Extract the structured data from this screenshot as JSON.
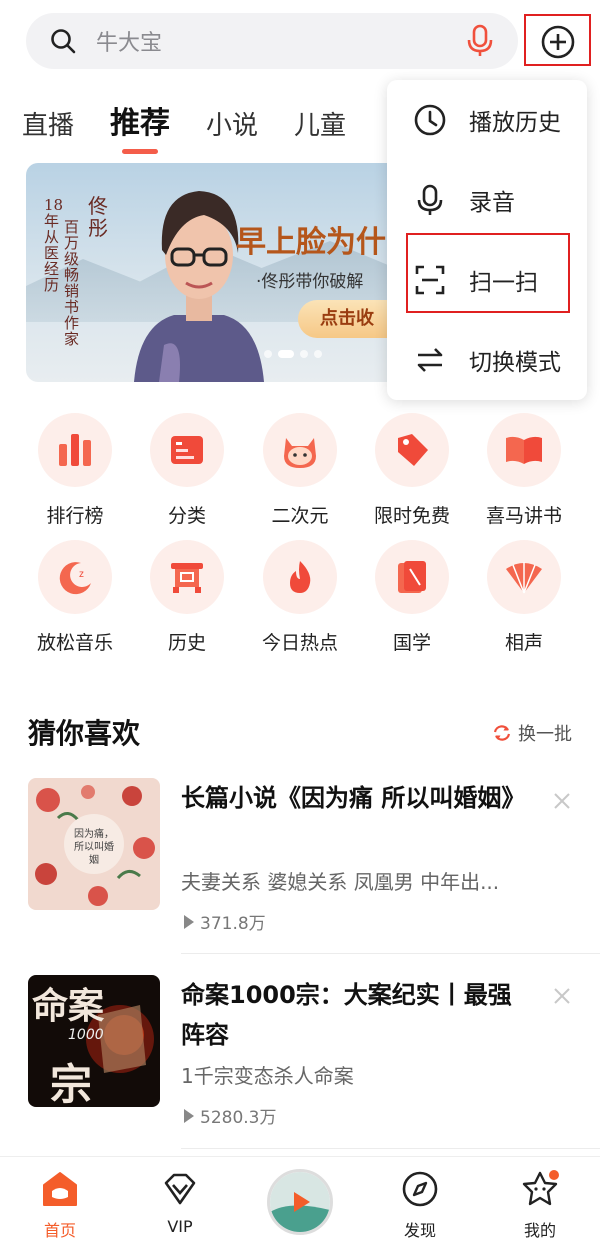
{
  "search": {
    "placeholder": "牛大宝"
  },
  "tabs": [
    "直播",
    "推荐",
    "小说",
    "儿童"
  ],
  "banner": {
    "vertical_1": "18年从医经历",
    "vertical_2": "百万级畅销书作家",
    "vertical_3": "佟彤",
    "headline": "早上脸为什",
    "subline": "·佟彤带你破解",
    "cta": "点击收"
  },
  "menu": [
    "播放历史",
    "录音",
    "扫一扫",
    "切换模式"
  ],
  "grid": [
    {
      "label": "排行榜",
      "icon": "ranking-icon"
    },
    {
      "label": "分类",
      "icon": "category-icon"
    },
    {
      "label": "二次元",
      "icon": "anime-icon"
    },
    {
      "label": "限时免费",
      "icon": "free-tag-icon"
    },
    {
      "label": "喜马讲书",
      "icon": "book-icon"
    },
    {
      "label": "放松音乐",
      "icon": "moon-icon"
    },
    {
      "label": "历史",
      "icon": "history-gate-icon"
    },
    {
      "label": "今日热点",
      "icon": "flame-icon"
    },
    {
      "label": "国学",
      "icon": "scroll-icon"
    },
    {
      "label": "相声",
      "icon": "fan-icon"
    }
  ],
  "guess": {
    "title": "猜你喜欢",
    "refresh": "换一批",
    "items": [
      {
        "title": "长篇小说《因为痛 所以叫婚姻》",
        "desc": "夫妻关系 婆媳关系 凤凰男 中年出...",
        "plays": "371.8万",
        "cover_text": "因为痛，所以叫婚姻"
      },
      {
        "title": "命案1000宗：大案纪实丨最强阵容",
        "desc": "1千宗变态杀人命案",
        "plays": "5280.3万",
        "cover_text_big": "命案",
        "cover_text_small": "1000",
        "cover_text_big2": "宗"
      }
    ]
  },
  "bottom_nav": [
    {
      "label": "首页",
      "icon": "home-icon"
    },
    {
      "label": "VIP",
      "icon": "vip-icon"
    },
    {
      "label": "发现",
      "icon": "discover-icon"
    },
    {
      "label": "我的",
      "icon": "profile-icon"
    }
  ],
  "colors": {
    "accent": "#f45d4a",
    "highlight_box": "#e02020"
  }
}
